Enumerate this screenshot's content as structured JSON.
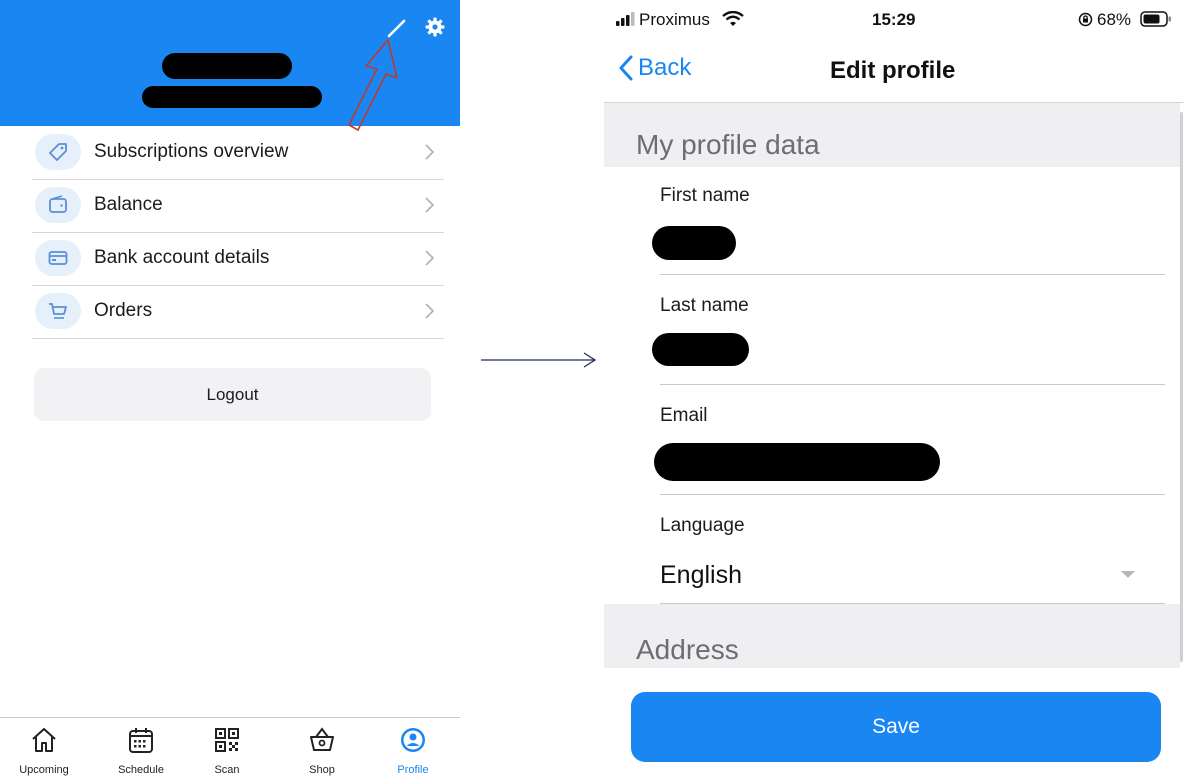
{
  "left_screen": {
    "header": {
      "background": "#1a86f1"
    },
    "menu": [
      {
        "label": "Subscriptions overview",
        "icon": "ticket-icon"
      },
      {
        "label": "Balance",
        "icon": "wallet-icon"
      },
      {
        "label": "Bank account details",
        "icon": "credit-card-icon"
      },
      {
        "label": "Orders",
        "icon": "cart-icon"
      }
    ],
    "logout_label": "Logout",
    "tabs": [
      {
        "label": "Upcoming",
        "icon": "home-icon"
      },
      {
        "label": "Schedule",
        "icon": "calendar-icon"
      },
      {
        "label": "Scan",
        "icon": "qr-code-icon"
      },
      {
        "label": "Shop",
        "icon": "basket-icon"
      },
      {
        "label": "Profile",
        "icon": "profile-icon",
        "active": true
      }
    ],
    "active_tab_color": "#1a86f1"
  },
  "right_screen": {
    "status_bar": {
      "carrier": "Proximus",
      "time": "15:29",
      "battery": "68%"
    },
    "nav": {
      "back_label": "Back",
      "title": "Edit profile"
    },
    "sections": {
      "profile_title": "My profile data",
      "address_title": "Address"
    },
    "fields": {
      "first_name_label": "First name",
      "last_name_label": "Last name",
      "email_label": "Email",
      "language_label": "Language",
      "language_value": "English"
    },
    "save_label": "Save",
    "accent": "#1a86f1"
  }
}
